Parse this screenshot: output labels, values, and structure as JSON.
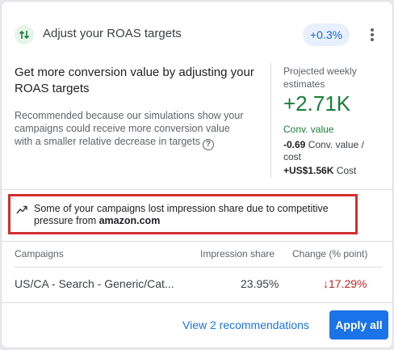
{
  "header": {
    "title": "Adjust your ROAS targets",
    "badge": "+0.3%",
    "icon": "swap-vertical-icon",
    "menu_icon": "more-vert-icon"
  },
  "body": {
    "headline": "Get more conversion value by adjusting your ROAS targets",
    "reason": "Recommended because our simulations show your campaigns could receive more conversion value with a smaller relative decrease in targets",
    "help_symbol": "?"
  },
  "projection": {
    "label": "Projected weekly estimates",
    "value": "+2.71K",
    "unit": "Conv. value",
    "line1_value": "-0.69",
    "line1_label": "Conv. value / cost",
    "line2_value": "+US$1.56K",
    "line2_label": "Cost"
  },
  "insight": {
    "text": "Some of your campaigns lost impression share due to competitive pressure from ",
    "competitor": "amazon.com",
    "icon": "trending-up-icon"
  },
  "table": {
    "headers": [
      "Campaigns",
      "Impression share",
      "Change (% point)"
    ],
    "rows": [
      {
        "campaign": "US/CA - Search - Generic/Cat...",
        "impression_share": "23.95%",
        "change_arrow": "↓",
        "change": "17.29%"
      }
    ]
  },
  "footer": {
    "view_link": "View 2 recommendations",
    "apply_button": "Apply all"
  },
  "colors": {
    "accent": "#1a73e8",
    "positive": "#188038",
    "negative": "#c5221f",
    "highlight_border": "#d32f2f"
  }
}
